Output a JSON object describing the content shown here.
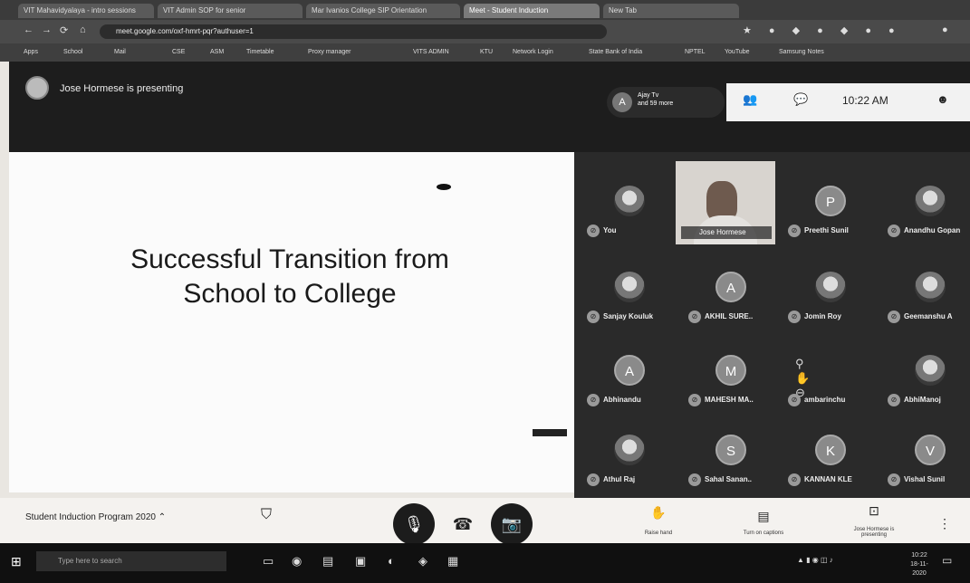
{
  "browser": {
    "tabs": [
      {
        "label": "VIT Mahavidyalaya - intro sessions"
      },
      {
        "label": "VIT Admin SOP for senior"
      },
      {
        "label": "Mar Ivanios College SIP Orientation"
      },
      {
        "label": "Meet - Student Induction"
      },
      {
        "label": "New Tab"
      }
    ],
    "url": "meet.google.com/oxf-hmrt-pqr?authuser=1",
    "bookmarks": [
      "Apps",
      "School",
      "Mail",
      "CSE",
      "ASM",
      "Timetable",
      "Proxy manager",
      "VITS ADMIN",
      "KTU",
      "Network Login",
      "State Bank of India",
      "NPTEL",
      "YouTube",
      "Samsung Notes"
    ]
  },
  "meet": {
    "presenter_label": "Jose Hormese is presenting",
    "participant_count": {
      "avatar": "A",
      "line1": "Ajay Tv",
      "line2": "and 59 more"
    },
    "clock": "10:22 AM",
    "slide": {
      "title_line1": "Successful Transition from",
      "title_line2": "School to College"
    },
    "video_tile_name": "Jose Hormese",
    "tiles": [
      {
        "name": "You",
        "avatar": "",
        "kind": "photo"
      },
      {
        "name": "Preethi Sunil",
        "avatar": "P",
        "kind": "letter"
      },
      {
        "name": "Anandhu Gopan",
        "avatar": "",
        "kind": "photo"
      },
      {
        "name": "Sanjay Kouluk",
        "avatar": "",
        "kind": "photo"
      },
      {
        "name": "AKHIL SURE..",
        "avatar": "A",
        "kind": "letter"
      },
      {
        "name": "Jomin Roy",
        "avatar": "",
        "kind": "photo"
      },
      {
        "name": "Geemanshu A",
        "avatar": "",
        "kind": "photo"
      },
      {
        "name": "Abhinandu",
        "avatar": "A",
        "kind": "letter"
      },
      {
        "name": "MAHESH MA..",
        "avatar": "M",
        "kind": "letter"
      },
      {
        "name": "ambarinchu",
        "avatar": "",
        "kind": "controls"
      },
      {
        "name": "AbhiManoj",
        "avatar": "",
        "kind": "photo"
      },
      {
        "name": "Athul Raj",
        "avatar": "",
        "kind": "photo"
      },
      {
        "name": "Sahal Sanan..",
        "avatar": "S",
        "kind": "letter"
      },
      {
        "name": "KANNAN KLE",
        "avatar": "K",
        "kind": "letter"
      },
      {
        "name": "Vishal Sunil",
        "avatar": "V",
        "kind": "letter"
      }
    ],
    "meeting_name": "Student Induction Program 2020",
    "actions": [
      {
        "icon": "hand-icon",
        "label": "Raise hand"
      },
      {
        "icon": "captions-icon",
        "label": "Turn on captions"
      },
      {
        "icon": "present-icon",
        "label": "Jose Hormese is presenting"
      }
    ]
  },
  "taskbar": {
    "search_placeholder": "Type here to search",
    "time": "10:22",
    "date": "18-11-2020"
  }
}
